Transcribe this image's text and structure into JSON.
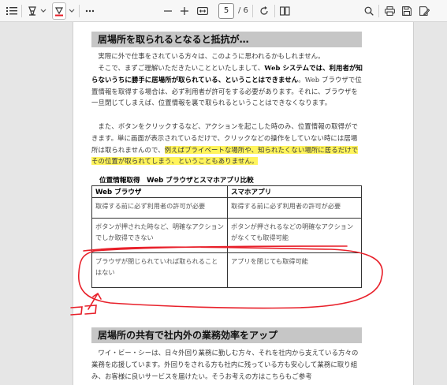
{
  "toolbar": {
    "page_current": "5",
    "page_total": "/ 6",
    "icons": [
      "list-icon",
      "highlighter-icon",
      "chevron-down-icon",
      "draw-icon",
      "chevron-down-icon",
      "more-icon",
      "zoom-out-icon",
      "zoom-in-icon",
      "fit-page-icon",
      "rotate-icon",
      "page-view-icon",
      "search-icon",
      "print-icon",
      "save-icon",
      "save-as-icon"
    ]
  },
  "doc": {
    "heading1": "居場所を取られるとなると抵抗が…",
    "p1": "実際に外で仕事をされている方々は、このように思われるかもしれません。",
    "p2_a": "そこで、まずご理解いただきたいことといたしまして、",
    "p2_b": "Web システムでは、利用者が知らないうちに勝手に居場所が取られている、ということはできません",
    "p2_c": "。Web ブラウザで位置情報を取得する場合は、必ず利用者が許可をする必要があります。それに、ブラウザを一旦閉じてしまえば、位置情報を裏で取られるということはできなくなります。",
    "p3_a": "また、ボタンをクリックするなど、アクションを起こした時のみ、位置情報の取得ができます。単に画面が表示されているだけで、クリックなどの操作をしていない時には居場所は取られませんので、",
    "p3_hl": "例えばプライベートな場所や、知られたくない場所に居るだけでその位置が取られてしまう、ということもありません。",
    "table_caption": "位置情報取得　Web ブラウザとスマホアプリ比較",
    "table_headers": [
      "Web ブラウザ",
      "スマホアプリ"
    ],
    "table_rows": [
      [
        "取得する前に必ず利用者の許可が必要",
        "取得する前に必ず利用者の許可が必要"
      ],
      [
        "ボタンが押された時など、明確なアクションでしか取得できない",
        "ボタンが押されるなどの明確なアクションがなくても取得可能"
      ],
      [
        "ブラウザが閉じられていれば取られることはない",
        "アプリを閉じても取得可能"
      ]
    ],
    "heading2": "居場所の共有で社内外の業務効率をアップ",
    "p4": "ワイ・ビー・シーは、日々外回り業務に勤しむ方々、それを社内から支えている方々の業務を応援しています。外回りをされる方も社内に残っている方も安心して業務に取り組み、お客様に良いサービスを届けたい。そうお考えの方はこちらもご参考"
  },
  "annotation": {
    "handwritten_text": "ココ",
    "ink_color": "#e8202a"
  }
}
